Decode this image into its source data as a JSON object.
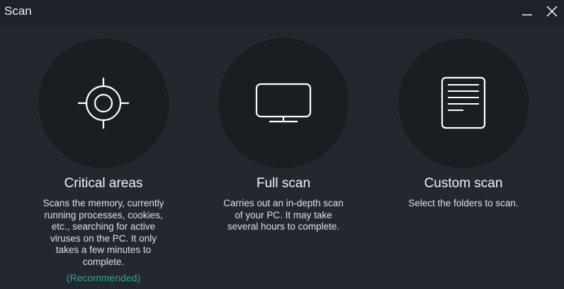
{
  "window": {
    "title": "Scan",
    "minimize_icon": "minimize-icon",
    "close_icon": "close-icon"
  },
  "options": [
    {
      "icon": "crosshair-icon",
      "title": "Critical areas",
      "description": "Scans the memory, currently\nrunning processes, cookies,\netc., searching for active\nviruses on the PC. It only\ntakes a few minutes to\ncomplete.",
      "note": "(Recommended)"
    },
    {
      "icon": "monitor-icon",
      "title": "Full scan",
      "description": "Carries out an in-depth scan\nof your PC. It may take\nseveral hours to complete."
    },
    {
      "icon": "document-icon",
      "title": "Custom scan",
      "description": "Select the folders to scan."
    }
  ],
  "colors": {
    "background": "#23282e",
    "icon_circle": "#1a1e22",
    "accent": "#2fa59a",
    "text": "#e9ecef"
  }
}
